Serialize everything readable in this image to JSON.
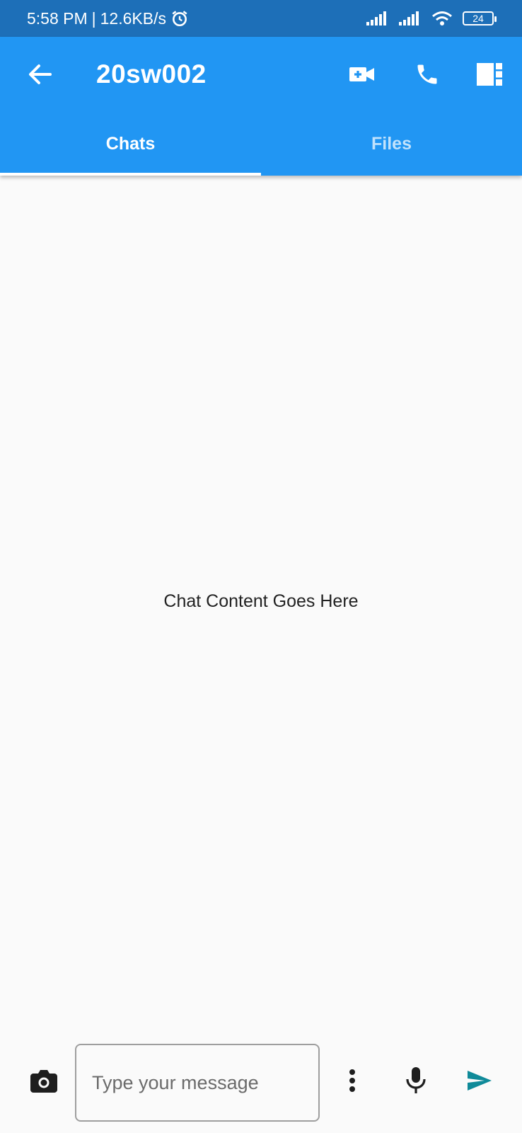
{
  "status_bar": {
    "time": "5:58 PM",
    "separator": "|",
    "speed": "12.6KB/s",
    "battery": "24"
  },
  "header": {
    "title": "20sw002",
    "icons": [
      "back-arrow-icon",
      "video-call-icon",
      "phone-icon",
      "side-panel-icon"
    ]
  },
  "tabs": [
    {
      "label": "Chats",
      "selected": true
    },
    {
      "label": "Files",
      "selected": false
    }
  ],
  "main": {
    "placeholder_text": "Chat Content Goes Here"
  },
  "composer": {
    "input_value": "",
    "input_placeholder": "Type your message",
    "icons": [
      "camera-icon",
      "more-vert-icon",
      "mic-icon",
      "send-icon"
    ]
  },
  "colors": {
    "status_bar": "#1d6fb8",
    "app_bar": "#2196f3",
    "background": "#fafafa",
    "send_icon": "#0f8a99"
  }
}
